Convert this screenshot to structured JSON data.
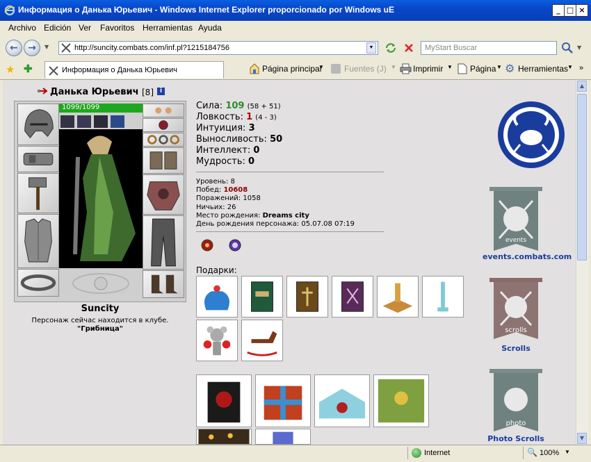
{
  "window": {
    "title": "Информация о Данька Юрьевич - Windows Internet Explorer proporcionado por Windows uE"
  },
  "menu": [
    "Archivo",
    "Edición",
    "Ver",
    "Favoritos",
    "Herramientas",
    "Ayuda"
  ],
  "address": {
    "url": "http://suncity.combats.com/inf.pl?1215184756",
    "search_placeholder": "MyStart Buscar"
  },
  "tab": {
    "title": "Информация о Данька Юрьевич"
  },
  "toolbar": {
    "home": "Página principal",
    "feeds": "Fuentes (J)",
    "print": "Imprimir",
    "page": "Página",
    "tools": "Herramientas"
  },
  "character": {
    "name": "Данька Юрьевич",
    "level_badge": "[8]",
    "hp": "1099/1099",
    "hp_fraction": 1.0,
    "city": "Suncity",
    "club_text": "Персонаж сейчас находится в клубе.",
    "club_name": "\"Грибница\""
  },
  "stats": [
    {
      "label": "Сила:",
      "value": "109",
      "extra": "(58 + 51)",
      "color": "#2e8b2e"
    },
    {
      "label": "Ловкость:",
      "value": "1",
      "extra": "(4 - 3)",
      "color": "#b00000"
    },
    {
      "label": "Интуиция:",
      "value": "3",
      "extra": "",
      "color": "#000000"
    },
    {
      "label": "Выносливость:",
      "value": "50",
      "extra": "",
      "color": "#000000"
    },
    {
      "label": "Интеллект:",
      "value": "0",
      "extra": "",
      "color": "#000000"
    },
    {
      "label": "Мудрость:",
      "value": "0",
      "extra": "",
      "color": "#000000"
    }
  ],
  "info": {
    "level_label": "Уровень:",
    "level_value": "8",
    "wins_label": "Побед:",
    "wins_value": "10608",
    "losses_label": "Поражений:",
    "losses_value": "1058",
    "draws_label": "Ничьих:",
    "draws_value": "26",
    "birthplace_label": "Место рождения:",
    "birthplace_value": "Dreams city",
    "birthday_label": "День рождения персонажа:",
    "birthday_value": "05.07.08 07:19"
  },
  "gifts_label": "Подарки:",
  "banners": {
    "events_caption": "events",
    "events_link": "events.combats.com",
    "scrolls_caption": "scrolls",
    "scrolls_link": "Scrolls",
    "photo_caption": "photo",
    "photo_link": "Photo Scrolls"
  },
  "status": {
    "zone": "Internet",
    "zoom": "100%"
  },
  "colors": {
    "accent": "#1a3c9c",
    "hp_bar": "#1fa71f",
    "content_bg": "#e2e0e0"
  }
}
